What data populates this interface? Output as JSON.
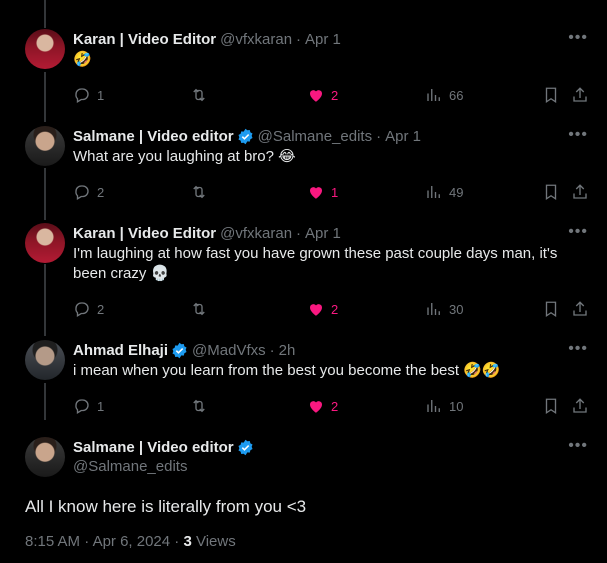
{
  "replies": [
    {
      "name": "Karan | Video Editor",
      "handle": "@vfxkaran",
      "date": "Apr 1",
      "text": "🤣",
      "verified": false,
      "replies": "1",
      "retweets": "",
      "likes": "2",
      "views": "66"
    },
    {
      "name": "Salmane | Video editor",
      "handle": "@Salmane_edits",
      "date": "Apr 1",
      "text": "What are you laughing at bro? 😂",
      "verified": true,
      "replies": "2",
      "retweets": "",
      "likes": "1",
      "views": "49"
    },
    {
      "name": "Karan | Video Editor",
      "handle": "@vfxkaran",
      "date": "Apr 1",
      "text": "I'm laughing at how fast you have grown these past couple days man, it's been crazy 💀",
      "verified": false,
      "replies": "2",
      "retweets": "",
      "likes": "2",
      "views": "30"
    },
    {
      "name": "Ahmad Elhaji",
      "handle": "@MadVfxs",
      "date": "2h",
      "text": "i mean when you learn from the best you become the best 🤣🤣",
      "verified": true,
      "replies": "1",
      "retweets": "",
      "likes": "2",
      "views": "10"
    }
  ],
  "main": {
    "name": "Salmane | Video editor",
    "handle": "@Salmane_edits",
    "text": "All I know here is literally from you <3",
    "time": "8:15 AM",
    "date": "Apr 6, 2024",
    "views_count": "3",
    "views_label": "Views"
  },
  "colors": {
    "like": "#f91880",
    "verified": "#1d9bf0",
    "muted": "#71767b",
    "text": "#e7e9ea"
  },
  "icons": [
    "reply-icon",
    "retweet-icon",
    "heart-icon",
    "views-icon",
    "bookmark-icon",
    "share-icon",
    "more-icon",
    "verified-badge-icon"
  ]
}
